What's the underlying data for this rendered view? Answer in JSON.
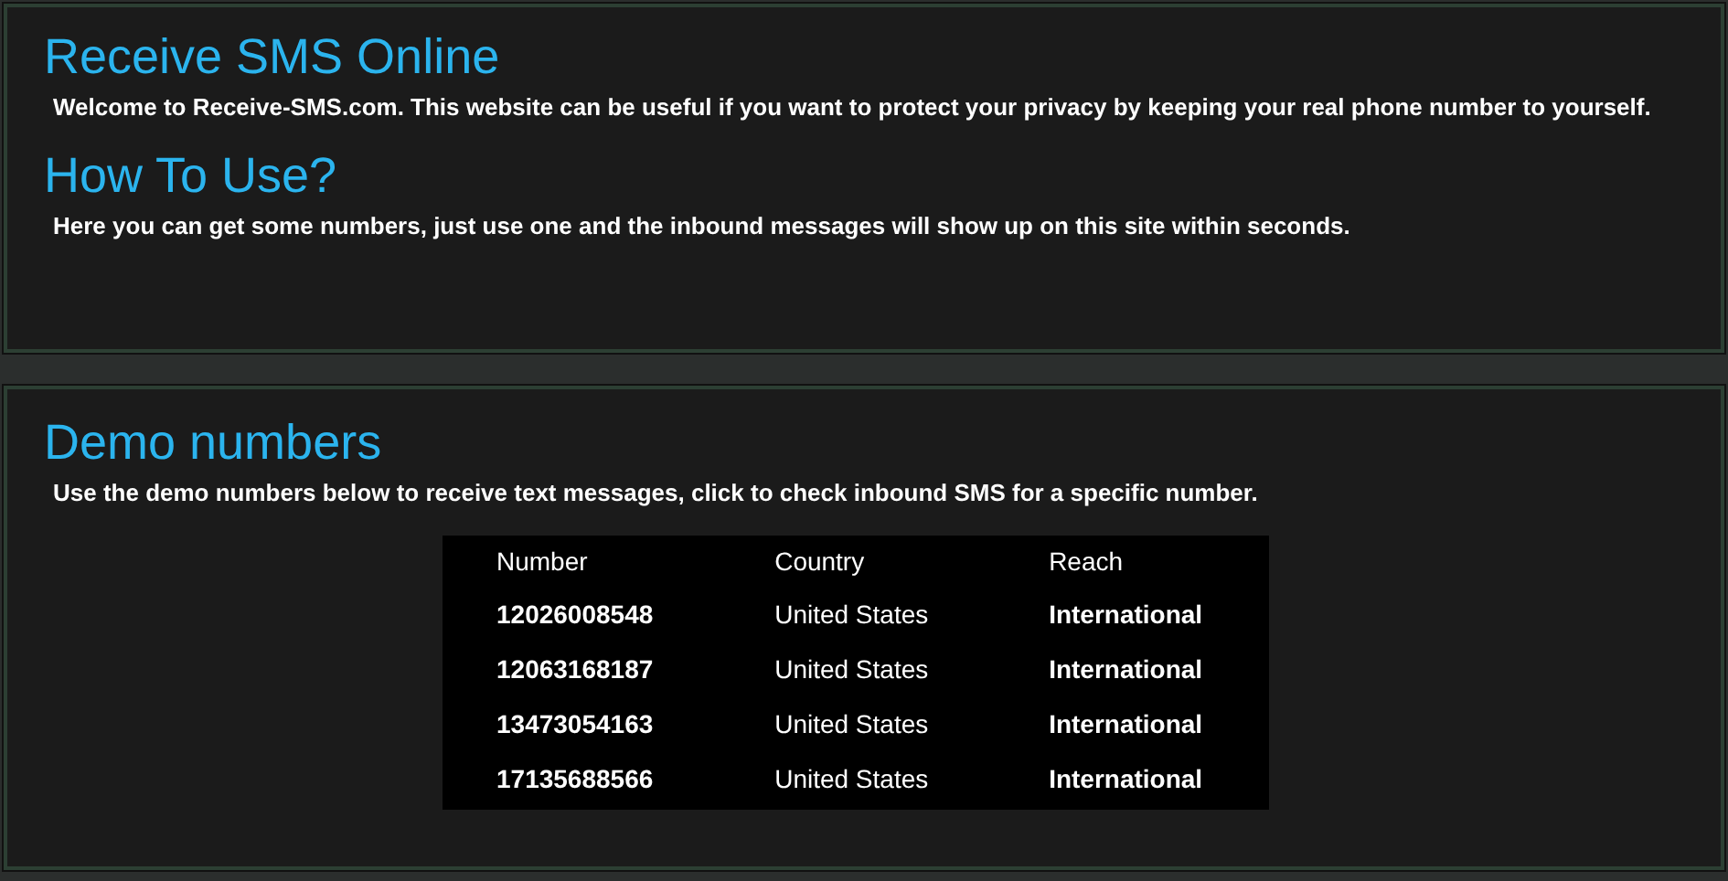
{
  "intro_panel": {
    "title": "Receive SMS Online",
    "text": "Welcome to Receive-SMS.com. This website can be useful if you want to protect your privacy by keeping your real phone number to yourself.",
    "subtitle": "How To Use?",
    "subtext": "Here you can get some numbers, just use one and the inbound messages will show up on this site within seconds."
  },
  "demo_panel": {
    "title": "Demo numbers",
    "text": "Use the demo numbers below to receive text messages, click to check inbound SMS for a specific number.",
    "table": {
      "columns": [
        "Number",
        "Country",
        "Reach"
      ],
      "rows": [
        [
          "12026008548",
          "United States",
          "International"
        ],
        [
          "12063168187",
          "United States",
          "International"
        ],
        [
          "13473054163",
          "United States",
          "International"
        ],
        [
          "17135688566",
          "United States",
          "International"
        ]
      ]
    }
  }
}
